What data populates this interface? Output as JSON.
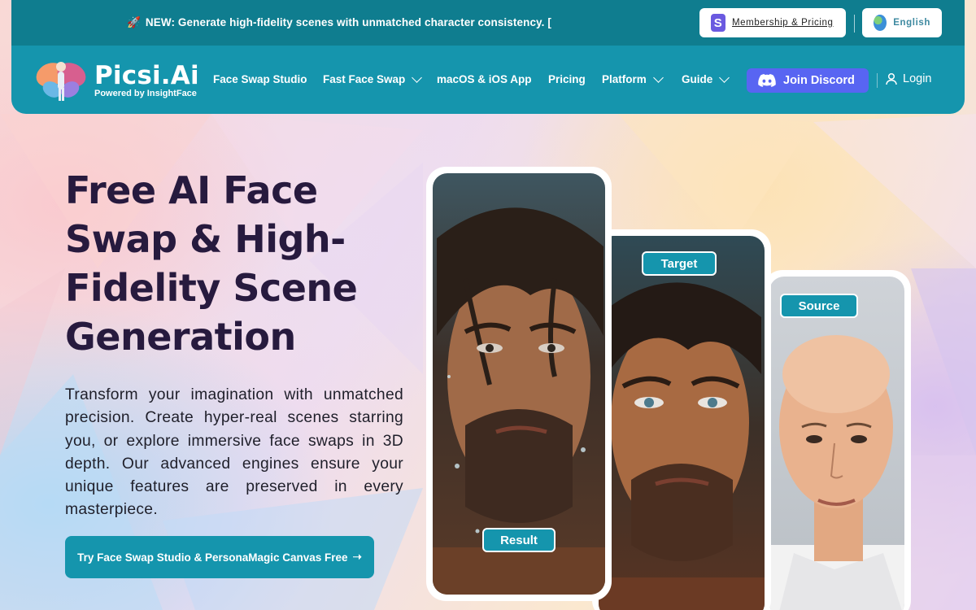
{
  "announcement": {
    "text": "NEW: Generate high-fidelity scenes with unmatched character consistency. ["
  },
  "top_actions": {
    "membership_label": "Membership & Pricing",
    "language_label": "English"
  },
  "brand": {
    "name": "Picsi.Ai",
    "tagline": "Powered by InsightFace"
  },
  "nav": {
    "items": [
      {
        "label": "Face Swap Studio",
        "dropdown": false
      },
      {
        "label": "Fast Face Swap",
        "dropdown": true
      },
      {
        "label": "macOS & iOS App",
        "dropdown": false
      },
      {
        "label": "Pricing",
        "dropdown": false
      },
      {
        "label": "Platform",
        "dropdown": true
      },
      {
        "label": "Guide",
        "dropdown": true
      }
    ],
    "discord_label": "Join Discord",
    "login_label": "Login"
  },
  "hero": {
    "title": "Free AI Face Swap & High-Fidelity Scene Generation",
    "description": "Transform your imagination with unmatched precision. Create hyper-real scenes starring you, or explore immersive face swaps in 3D depth. Our advanced engines ensure your unique features are preserved in every masterpiece.",
    "cta_label": "Try Face Swap Studio & PersonaMagic Canvas Free"
  },
  "showcase": {
    "result_label": "Result",
    "target_label": "Target",
    "source_label": "Source"
  },
  "colors": {
    "primary": "#1595ad",
    "topbar": "#0f7d8f",
    "discord": "#5865f2",
    "title": "#271a3e"
  }
}
